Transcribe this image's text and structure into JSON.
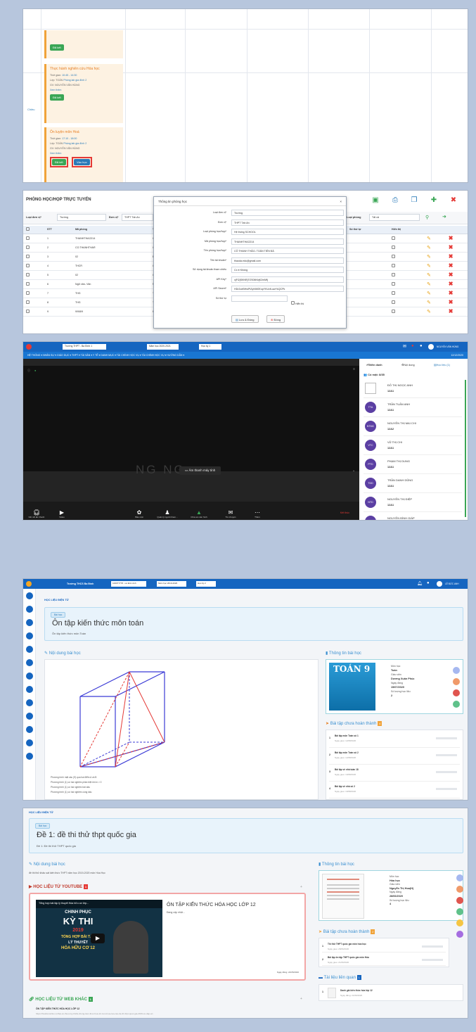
{
  "p1": {
    "card1": {
      "title": "Thực hành nghiên cứu Hóa học",
      "time_label": "Thời gian",
      "time": "10:45 - 14:30",
      "room_label": "Lớp: TOÁN",
      "room": "Phòng lab gia đình 2",
      "teacher": "GV: NGUYỄN VĂN HÙNG",
      "more": "Xem thêm",
      "btn": "Đã kết"
    },
    "card2": {
      "title": "Ôn luyện môn Hoá",
      "time_label": "Thời gian",
      "time": "17:10 - 18:00",
      "room_label": "Lớp: TOÁN",
      "room": "Phòng lab gia đình 2",
      "teacher": "GV: NGUYỄN VĂN HÙNG",
      "more": "Xem thêm",
      "btn1": "Đã kết",
      "btn2": "Vào học"
    },
    "day_label": "Chiều",
    "top_btn": "Đã kết"
  },
  "p2": {
    "title": "PHÒNG HỌC/HỌP TRỰC TUYẾN",
    "filters": {
      "l1": "Loại đơn vị*",
      "v1": "Trường",
      "l2": "Đơn vị*",
      "v2": "THPT Tấn An",
      "l3": "Loại phòng",
      "v3": "Tất cả"
    },
    "headers": [
      "STT",
      "Mã phòng",
      "Tên phòng",
      "Số thứ tự",
      "Hiển thị"
    ],
    "rows": [
      {
        "stt": "1",
        "code": "THANHTHAO214",
        "name": "CÔ THANH T"
      },
      {
        "stt": "2",
        "code": "CO.THANHTHAR",
        "name": "GDCD"
      },
      {
        "stt": "3",
        "code": "02",
        "name": "Bio"
      },
      {
        "stt": "4",
        "code": "THCR",
        "name": "Cô Hương - T"
      },
      {
        "stt": "5",
        "code": "02",
        "name": "Cô Hải: Hoá V"
      },
      {
        "stt": "6",
        "code": "Ngữ văn- Văn",
        "name": "Ngữ văn 11 - I"
      },
      {
        "stt": "7",
        "code": "THG",
        "name": "Thầy Hưng Mat"
      },
      {
        "stt": "8",
        "code": "THG",
        "name": "Tin học - TH"
      },
      {
        "stt": "9",
        "code": "9/9/8/9",
        "name": "HOÁ HỌC 10 - Cô hào"
      }
    ],
    "modal": {
      "title": "Thông tin phòng học",
      "fields": [
        {
          "label": "Loại đơn vị*",
          "value": "Trường"
        },
        {
          "label": "Đơn vị*",
          "value": "THPT Tấn An"
        },
        {
          "label": "Loại phòng học/họp*",
          "value": "Hệ thống SCHOOL"
        },
        {
          "label": "Mã phòng học/họp*",
          "value": "THANHTHAO214"
        },
        {
          "label": "Tên phòng học/họp*",
          "value": "CÔ THANH THẢO- TOÁN TIẾN ĐÁ"
        },
        {
          "label": "Tên tài khoản*",
          "value": "thaoda.edu@gmail.com"
        },
        {
          "label": "Sử dụng tài khoản tham chiếu",
          "value": "Có  ● Không"
        },
        {
          "label": "API Key*",
          "value": "xjFI2jSKNRj7OS06KbjK2mMfj"
        },
        {
          "label": "API Secret*",
          "value": "HDr2oeBHwPtZyNW0EopYKUvfLuwYkQCPk"
        },
        {
          "label": "Số thứ tự",
          "value": ""
        }
      ],
      "show": "Hiển thị",
      "save": "Lưu & Đóng",
      "close": "Đóng"
    }
  },
  "p3": {
    "school": "Trường THPT - Ba Đình 1",
    "year": "Năm học 2020-2021",
    "term": "Học kỳ 1",
    "user": "NGUYỄN VĂN HÙNG",
    "date": "12/12/2020",
    "nav": "HỆ THỐNG ▾   NHÂN SỰ ▾   GIÁO DỤC ▾   THPT ▾   TÀI SẢN ▾   Y TẾ ▾   DANH MỤC ▾   TÀI CHÍNH HỌC VỤ ▾   TÀI CHÍNH HỌC VỤ ▾   HƯỚNG DẪN ▾",
    "video_name": "NG                       NG",
    "audio": "Âm thanh máy tính",
    "join": "Kết nối âm thanh bằng máy tính",
    "toolbar": [
      "Kết nối âm thanh",
      "Video",
      "Bảo mật",
      "Quản lý người tham...",
      "Chia sẻ màn hình",
      "Trò chuyện",
      "Thêm"
    ],
    "leave": "Kết thúc",
    "tabs": [
      "Điểm danh",
      "Nội dung",
      "Học liệu (1)"
    ],
    "present": "Có mặt: 8/35",
    "students": [
      {
        "init": "",
        "name": "ĐỖ THỊ NGỌC ANH",
        "cls": "12A1"
      },
      {
        "init": "TTA",
        "name": "TRẦN TUẤN ANH",
        "cls": "12A1"
      },
      {
        "init": "NTMC",
        "name": "NGUYỄN THỊ MAI CHI",
        "cls": "12A2"
      },
      {
        "init": "VTC",
        "name": "VŨ THỊ CHI",
        "cls": "12A1"
      },
      {
        "init": "PTD",
        "name": "PHẠM THỊ DUNG",
        "cls": "12A1"
      },
      {
        "init": "TDD",
        "name": "TRẦN DANH DŨNG",
        "cls": "12A1"
      },
      {
        "init": "NTD",
        "name": "NGUYỄN THỊ ĐIỆP",
        "cls": "12A1"
      },
      {
        "init": "NDG",
        "name": "NGUYỄN ĐÌNH GIÁP",
        "cls": "12A1"
      },
      {
        "init": "LTH",
        "name": "LƯƠNG THỊ HÀ",
        "cls": "12A1"
      }
    ]
  },
  "p4": {
    "app": "Trường THCS Ba Đình",
    "sel1": "100077778 - Lê Đức Anh",
    "sel2": "Năm học 2019-2020",
    "sel3": "Học kỳ 2",
    "user": "LÊ ĐỨC ANH",
    "crumb": "HỌC LIỆU ĐIỆN TỬ",
    "tag": "Bài học",
    "title": "Ôn tập kiến thức môn toán",
    "subtitle": "Ôn tập kiến thức môn Toán",
    "content_h": "Nội dung bài học",
    "notes": [
      "Phương trình mặt cầu (S) qua hai điểm A và B",
      "Phương trình (1) có hai nghiệm phân biệt khi m > 0",
      "Phương trình (1) có hai nghiệm trái dấu",
      "Phương trình (1) có hai nghiệm cùng dấu"
    ],
    "info_h": "Thông tin bài học",
    "info": {
      "subject_l": "Môn học",
      "subject": "Toán",
      "teacher_l": "Giáo viên",
      "teacher": "Dương Xuân Phúc",
      "date_l": "Ngày đăng",
      "date": "15/07/2020",
      "count_l": "Số lượng học liệu",
      "count": "2"
    },
    "book": "TOÁN 9",
    "hw_h": "Bài tập chưa hoàn thành",
    "hw_count": "4",
    "hw": [
      {
        "n": "1",
        "t": "Bài tập môn Toán số 1",
        "d": "Ngày giao: 12/08/2020"
      },
      {
        "n": "2",
        "t": "Bài tập môn Toán số 2",
        "d": "Ngày giao: 12/08/2020"
      },
      {
        "n": "3",
        "t": "Bài tập về nhà tuần 18",
        "d": "Ngày giao: 10/08/2020"
      },
      {
        "n": "4",
        "t": "Bài tập về nhà số 2",
        "d": "Ngày giao: 10/08/2020"
      }
    ]
  },
  "p5": {
    "crumb": "HỌC LIỆU ĐIỆN TỬ",
    "tag": "Bài học",
    "title": "Đề 1: đề thi thử thpt quốc gia",
    "subtitle": "Đề 1: Đề thi thử THPT quốc gia",
    "content_h": "Nội dung bài học",
    "content_text": "đề thi thử khảo sát kiến thức THPT năm học 2019-2020 môn Hóa Học",
    "yt_h": "HỌC LIỆU TỪ YOUTUBE",
    "yt_count": "1",
    "video_title": "ÔN TẬP KIẾN THỨC HÓA HỌC LỚP 12",
    "video_sub": "Đang cập nhật...",
    "video_thumb_title": "Tổng hợp bài tập lý thuyết Hóa hữu cơ lớp...",
    "thumb_lines": [
      "CHINH PHỤC",
      "KỲ THI",
      "2019",
      "TỔNG HỢP BÀI TẬP",
      "LÝ THUYẾT",
      "HÓA HỮU CƠ 12"
    ],
    "video_date": "Ngày đăng: 22/05/2020",
    "web_h": "HỌC LIỆU TỪ WEB KHÁC",
    "web_count": "1",
    "web_title": "ÔN TẬP KIẾN THỨC HÓA HỌC LỚP 12",
    "web_link": "https://hoahoconline.vn/bai-on-thuoc-ky-thi/de-thong-kien-thuc-hoa-12-mon-hoa-cao-cau-de-thi-thpt-quoc-gia-2019-co-dap-an",
    "info_h": "Thông tin bài học",
    "info": {
      "subject_l": "Môn học",
      "subject": "Hóa học",
      "teacher_l": "Giáo viên",
      "teacher": "Nguyễn Thị Hoa(H)",
      "date_l": "Ngày đăng",
      "date": "28/06/2020",
      "count_l": "Số lượng học liệu",
      "count": "4"
    },
    "hw_h": "Bài tập chưa hoàn thành",
    "hw_count": "2",
    "hw": [
      {
        "n": "1",
        "t": "Thi thử THPT quốc gia môn hóa học",
        "d": "Ngày giao: 28/06/2020"
      },
      {
        "n": "2",
        "t": "Bài tập ôn tập THPT quốc gia môn Hóa",
        "d": "Ngày giao: 21/06/2020"
      }
    ],
    "rel_h": "Tài liệu liên quan",
    "rel_count": "1",
    "rel": [
      {
        "n": "1",
        "t": "Danh giá kiến thức hóa lớp 12",
        "d": "Ngày đăng: 21/06/2020"
      }
    ]
  }
}
